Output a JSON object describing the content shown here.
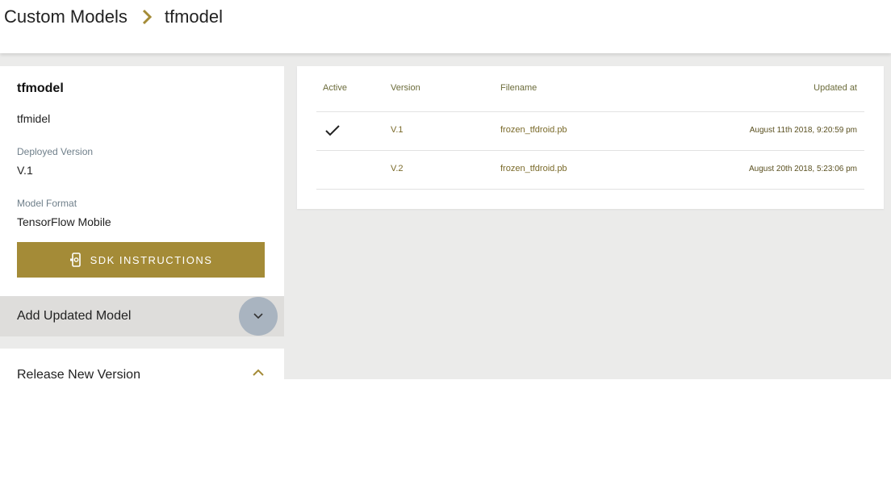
{
  "breadcrumb": {
    "parent": "Custom Models",
    "current": "tfmodel",
    "separator_icon": "chevron-right-icon",
    "separator_color": "#a48b37"
  },
  "model": {
    "name": "tfmodel",
    "description": "tfmidel",
    "deployed_version_label": "Deployed Version",
    "deployed_version": "V.1",
    "model_format_label": "Model Format",
    "model_format": "TensorFlow Mobile",
    "sdk_button_label": "SDK INSTRUCTIONS",
    "sdk_button_icon": "phone-settings-icon",
    "accent_color": "#a48b37"
  },
  "accordions": {
    "add_updated_model": {
      "label": "Add Updated Model",
      "icon": "chevron-down-icon",
      "expanded": false
    },
    "release_new_version": {
      "label": "Release New Version",
      "icon": "chevron-up-icon",
      "expanded": true
    }
  },
  "versions_table": {
    "columns": [
      "Active",
      "Version",
      "Filename",
      "Updated at"
    ],
    "rows": [
      {
        "active": true,
        "active_icon": "checkmark-icon",
        "version": "V.1",
        "filename": "frozen_tfdroid.pb",
        "updated_at": "August 11th 2018, 9:20:59 pm"
      },
      {
        "active": false,
        "version": "V.2",
        "filename": "frozen_tfdroid.pb",
        "updated_at": "August 20th 2018, 5:23:06 pm"
      }
    ]
  }
}
